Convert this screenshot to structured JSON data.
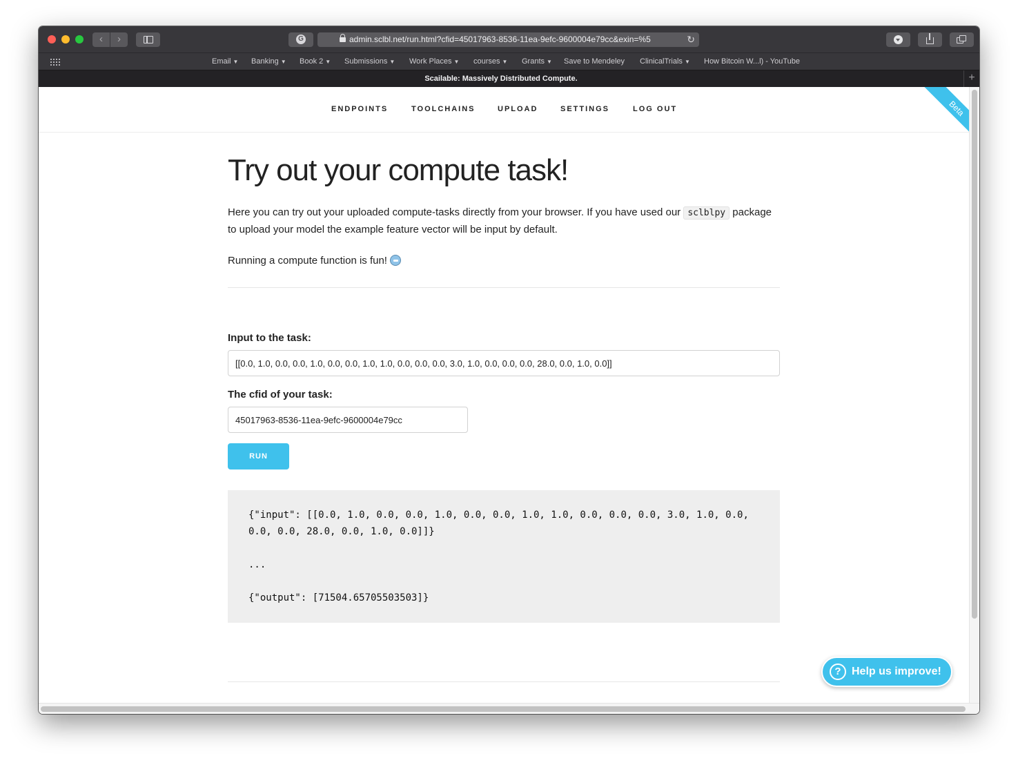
{
  "browser": {
    "url": "admin.sclbl.net/run.html?cfid=45017963-8536-11ea-9efc-9600004e79cc&exin=%5",
    "tab_title": "Scailable: Massively Distributed Compute.",
    "extension_letter": "G",
    "favorites": [
      {
        "label": "Email",
        "dropdown": true
      },
      {
        "label": "Banking",
        "dropdown": true
      },
      {
        "label": "Book 2",
        "dropdown": true
      },
      {
        "label": "Submissions",
        "dropdown": true
      },
      {
        "label": "Work Places",
        "dropdown": true
      },
      {
        "label": "courses",
        "dropdown": true
      },
      {
        "label": "Grants",
        "dropdown": true
      },
      {
        "label": "Save to Mendeley",
        "dropdown": false
      },
      {
        "label": "ClinicalTrials",
        "dropdown": true
      },
      {
        "label": "How Bitcoin W...l) - YouTube",
        "dropdown": false
      }
    ]
  },
  "site_nav": {
    "items": [
      "ENDPOINTS",
      "TOOLCHAINS",
      "UPLOAD",
      "SETTINGS",
      "LOG OUT"
    ],
    "ribbon": "Beta"
  },
  "main": {
    "title": "Try out your compute task!",
    "intro_before_code": "Here you can try out your uploaded compute-tasks directly from your browser. If you have used our ",
    "intro_code": "sclblpy",
    "intro_after_code": " package to upload your model the example feature vector will be input by default.",
    "fun_text": "Running a compute function is fun!",
    "input_label": "Input to the task:",
    "input_value": "[[0.0, 1.0, 0.0, 0.0, 1.0, 0.0, 0.0, 1.0, 1.0, 0.0, 0.0, 0.0, 3.0, 1.0, 0.0, 0.0, 0.0, 28.0, 0.0, 1.0, 0.0]]",
    "cfid_label": "The cfid of your task:",
    "cfid_value": "45017963-8536-11ea-9efc-9600004e79cc",
    "run_label": "RUN",
    "output_input_line": "{\"input\": [[0.0, 1.0, 0.0, 0.0, 1.0, 0.0, 0.0, 1.0, 1.0, 0.0, 0.0, 0.0, 3.0, 1.0, 0.0, 0.0, 0.0, 28.0, 0.0, 1.0, 0.0]]}",
    "output_ellipsis": "...",
    "output_result_line": "{\"output\": [71504.65705503503]}"
  },
  "help": {
    "label": "Help us improve!",
    "icon_glyph": "?"
  },
  "colors": {
    "accent": "#3fc1ec",
    "chrome": "#38373b"
  }
}
